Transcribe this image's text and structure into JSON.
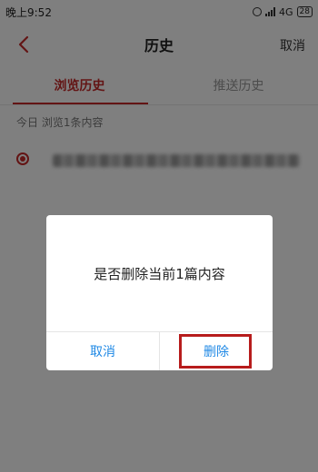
{
  "status_bar": {
    "time": "晚上9:52",
    "network": "4G",
    "battery": "28"
  },
  "nav": {
    "title": "历史",
    "cancel_label": "取消"
  },
  "tabs": [
    {
      "label": "浏览历史",
      "active": true
    },
    {
      "label": "推送历史",
      "active": false
    }
  ],
  "section_label": "今日 浏览1条内容",
  "dialog": {
    "message": "是否删除当前1篇内容",
    "cancel_label": "取消",
    "delete_label": "删除"
  },
  "colors": {
    "accent": "#c62828",
    "dialog_button": "#1e88e5",
    "highlight_border": "#b71c1c"
  }
}
